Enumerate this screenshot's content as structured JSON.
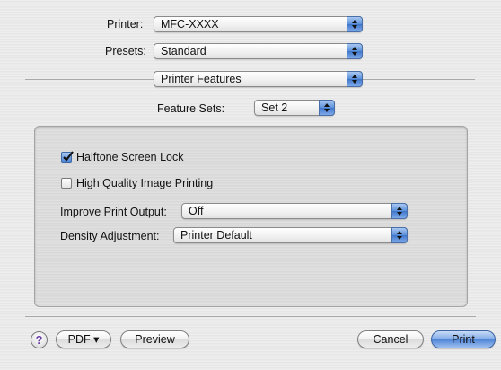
{
  "printer": {
    "label": "Printer:",
    "value": "MFC-XXXX"
  },
  "presets": {
    "label": "Presets:",
    "value": "Standard"
  },
  "pane": {
    "value": "Printer Features"
  },
  "feature_sets": {
    "label": "Feature Sets:",
    "value": "Set 2"
  },
  "options": {
    "halftone": {
      "label": "Halftone Screen Lock",
      "checked": true
    },
    "high_quality": {
      "label": "High Quality Image Printing",
      "checked": false
    },
    "improve_output": {
      "label": "Improve Print Output:",
      "value": "Off"
    },
    "density": {
      "label": "Density Adjustment:",
      "value": "Printer Default"
    }
  },
  "footer": {
    "help": "?",
    "pdf": "PDF ▾",
    "preview": "Preview",
    "cancel": "Cancel",
    "print": "Print"
  },
  "colors": {
    "accent": "#4f85d6",
    "help_glyph": "#6a3ca8"
  }
}
